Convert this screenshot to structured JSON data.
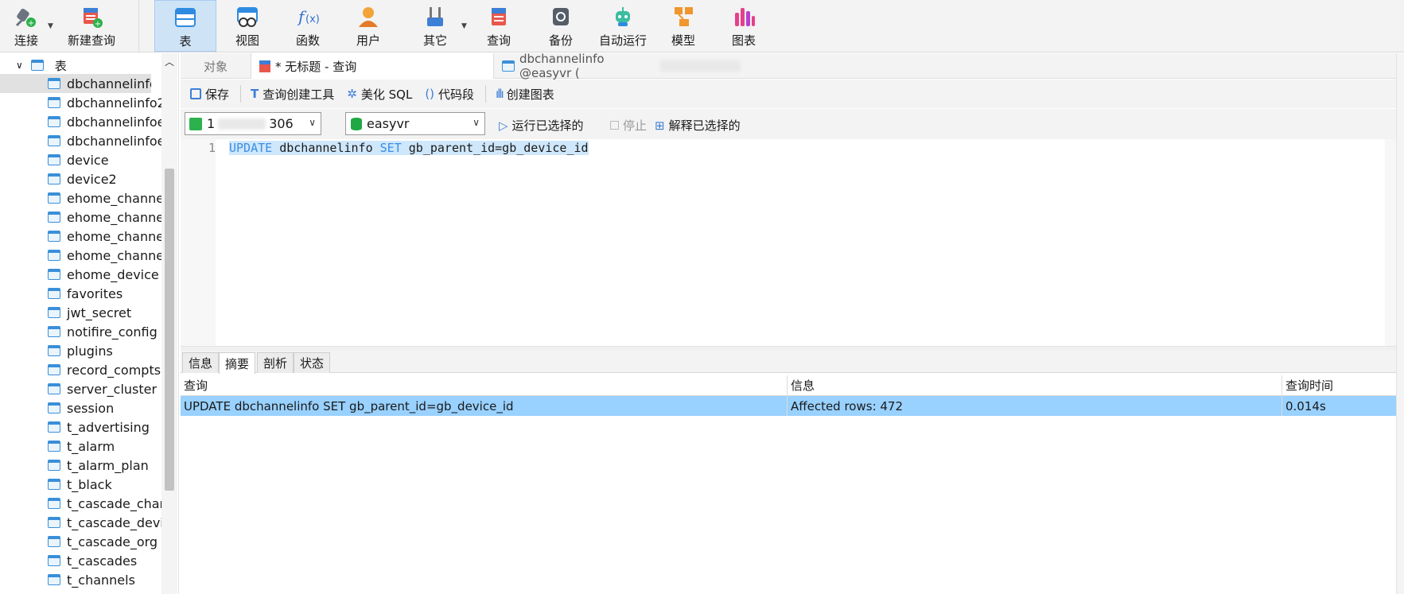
{
  "toolbar": {
    "connect": "连接",
    "new_query": "新建查询",
    "table": "表",
    "view": "视图",
    "function": "函数",
    "user": "用户",
    "other": "其它",
    "query": "查询",
    "backup": "备份",
    "automation": "自动运行",
    "model": "模型",
    "chart": "图表"
  },
  "sidebar": {
    "root_label": "表",
    "items": [
      "dbchannelinfo",
      "dbchannelinfo2",
      "dbchannelinfoerr",
      "dbchannelinfoerr",
      "device",
      "device2",
      "ehome_channel",
      "ehome_channel_",
      "ehome_channel_",
      "ehome_channel_",
      "ehome_device",
      "favorites",
      "jwt_secret",
      "notifire_config",
      "plugins",
      "record_compts",
      "server_cluster",
      "session",
      "t_advertising",
      "t_alarm",
      "t_alarm_plan",
      "t_black",
      "t_cascade_chann",
      "t_cascade_device",
      "t_cascade_org",
      "t_cascades",
      "t_channels"
    ]
  },
  "tabs": {
    "objects": "对象",
    "query_tab": "* 无标题 - 查询",
    "table_tab": "dbchannelinfo @easyvr ("
  },
  "editor_toolbar": {
    "save": "保存",
    "query_builder": "查询创建工具",
    "beautify": "美化 SQL",
    "snippet": "代码段",
    "create_chart": "创建图表"
  },
  "connection": {
    "conn_value": "1",
    "conn_suffix": "306",
    "database": "easyvr",
    "run_selected": "运行已选择的",
    "stop": "停止",
    "explain_selected": "解释已选择的"
  },
  "editor": {
    "line_number": "1",
    "kw1": "UPDATE",
    "part1": " dbchannelinfo ",
    "kw2": "SET",
    "part2": " gb_parent_id=gb_device_id"
  },
  "result_tabs": [
    "信息",
    "摘要",
    "剖析",
    "状态"
  ],
  "result_table": {
    "headers": [
      "查询",
      "信息",
      "查询时间"
    ],
    "rows": [
      [
        "UPDATE dbchannelinfo SET gb_parent_id=gb_device_id",
        "Affected rows: 472",
        "0.014s"
      ]
    ]
  },
  "colors": {
    "accent": "#3a8ee6",
    "selected_row": "#99d1ff",
    "active_toolbar": "#cfe3f7"
  }
}
